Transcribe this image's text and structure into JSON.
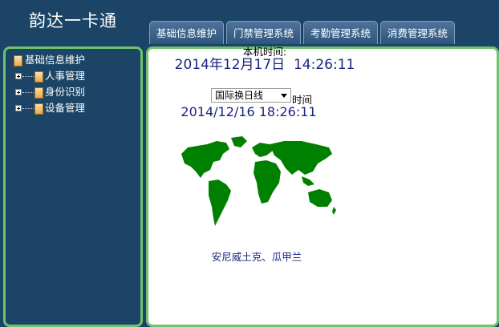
{
  "app": {
    "title": "韵达一卡通"
  },
  "tabs": [
    {
      "label": "基础信息维护"
    },
    {
      "label": "门禁管理系统"
    },
    {
      "label": "考勤管理系统"
    },
    {
      "label": "消费管理系统"
    }
  ],
  "sidebar": {
    "root": {
      "label": "基础信息维护",
      "icon": "folder-icon"
    },
    "items": [
      {
        "label": "人事管理",
        "icon": "folder-icon"
      },
      {
        "label": "身份识别",
        "icon": "folder-icon"
      },
      {
        "label": "设备管理",
        "icon": "folder-icon"
      }
    ]
  },
  "clock": {
    "local_label": "本机时间:",
    "local_time": "2014年12月17日  14:26:11",
    "timezone_selected": "国际换日线",
    "timezone_suffix": "时间",
    "zone_time": "2014/12/16 18:26:11",
    "zone_city": "安尼威土克、瓜甲兰"
  },
  "colors": {
    "background": "#1b4466",
    "panel_border": "#6fc26f",
    "time_text": "#1a237e",
    "map_land": "#008000"
  }
}
